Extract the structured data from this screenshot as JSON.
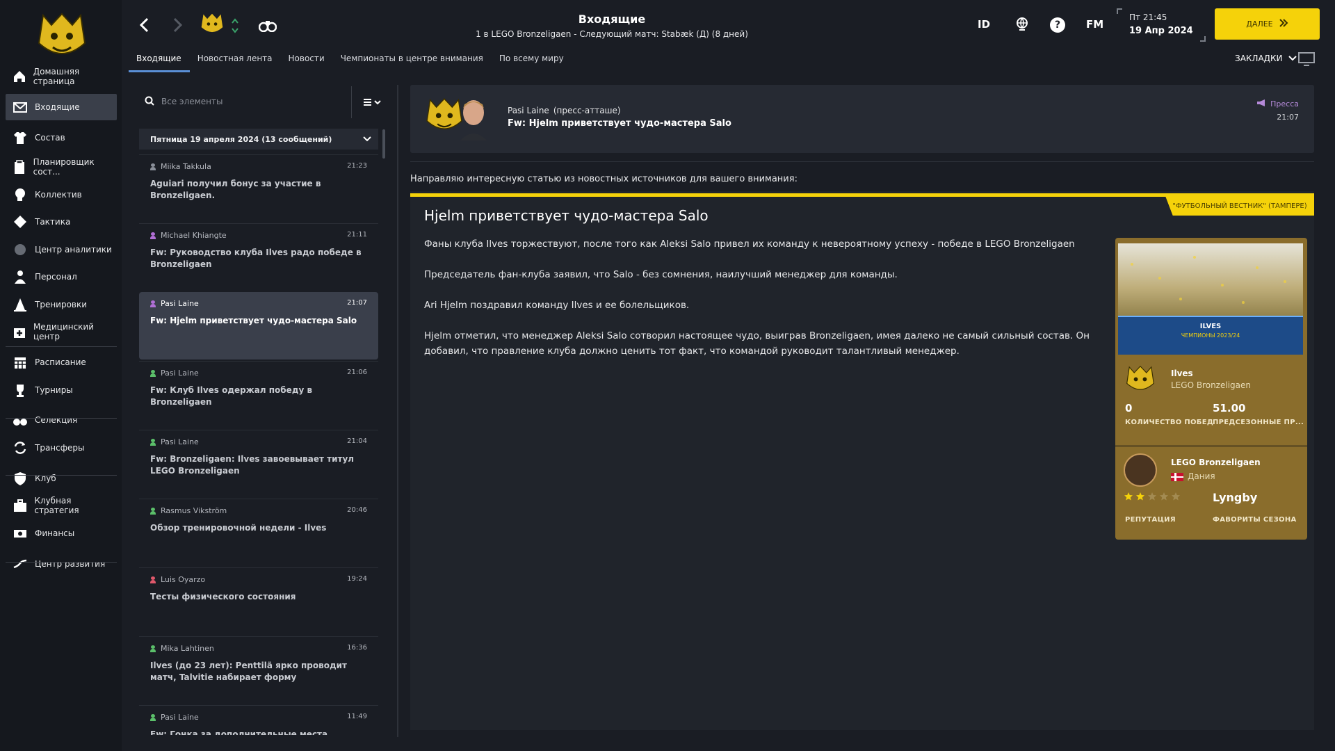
{
  "colors": {
    "accent": "#f5d20a",
    "tab_underline": "#5a8fd6",
    "card": "#8a6d2c"
  },
  "sidebar": {
    "items": [
      {
        "label": "Домашняя страница",
        "icon": "home-icon"
      },
      {
        "label": "Входящие",
        "icon": "mail-icon"
      },
      {
        "label": "Состав",
        "icon": "shirt-icon"
      },
      {
        "label": "Планировщик сост...",
        "icon": "clipboard-icon"
      },
      {
        "label": "Коллектив",
        "icon": "head-icon"
      },
      {
        "label": "Тактика",
        "icon": "tactics-icon"
      },
      {
        "label": "Центр аналитики",
        "icon": "analytics-icon"
      },
      {
        "label": "Персонал",
        "icon": "staff-icon"
      },
      {
        "label": "Тренировки",
        "icon": "cone-icon"
      },
      {
        "label": "Медицинский центр",
        "icon": "medical-icon"
      },
      {
        "label": "Расписание",
        "icon": "calendar-icon"
      },
      {
        "label": "Турниры",
        "icon": "trophy-icon"
      },
      {
        "label": "Селекция",
        "icon": "binoculars-icon"
      },
      {
        "label": "Трансферы",
        "icon": "transfer-icon"
      },
      {
        "label": "Клуб",
        "icon": "shield-icon"
      },
      {
        "label": "Клубная стратегия",
        "icon": "briefcase-icon"
      },
      {
        "label": "Финансы",
        "icon": "money-icon"
      },
      {
        "label": "Центр развития",
        "icon": "development-icon"
      }
    ]
  },
  "header": {
    "title": "Входящие",
    "subtitle": "1 в LEGO Bronzeligaen - Следующий матч: Stabæk (Д) (8 дней)",
    "id_label": "ID",
    "fm_label": "FM",
    "day_time": "Пт 21:45",
    "date": "19 Апр 2024",
    "next_label": "ДАЛЕЕ",
    "bookmarks_label": "ЗАКЛАДКИ"
  },
  "tabs": [
    "Входящие",
    "Новостная лента",
    "Новости",
    "Чемпионаты в центре внимания",
    "По всему миру"
  ],
  "search": {
    "placeholder": "Все элементы"
  },
  "group": {
    "label": "Пятница 19 апреля 2024 (13 сообщений)"
  },
  "messages": [
    {
      "sender": "Miika Takkula",
      "time": "21:23",
      "subject": "Aguiari получил бонус за участие в Bronzeligaen.",
      "color": "#8a8f99"
    },
    {
      "sender": "Michael Khiangte",
      "time": "21:11",
      "subject": "Fw: Руководство клуба Ilves радо победе в Bronzeligaen",
      "color": "#b16fd6"
    },
    {
      "sender": "Pasi Laine",
      "time": "21:07",
      "subject": "Fw: Hjelm приветствует чудо-мастера Salo",
      "color": "#b16fd6"
    },
    {
      "sender": "Pasi Laine",
      "time": "21:06",
      "subject": "Fw: Клуб Ilves одержал победу в Bronzeligaen",
      "color": "#5bbf6a"
    },
    {
      "sender": "Pasi Laine",
      "time": "21:04",
      "subject": "Fw: Bronzeligaen: Ilves завоевывает титул LEGO Bronzeligaen",
      "color": "#5bbf6a"
    },
    {
      "sender": "Rasmus Vikström",
      "time": "20:46",
      "subject": "Обзор тренировочной недели - Ilves",
      "color": "#5bbf6a"
    },
    {
      "sender": "Luis Oyarzo",
      "time": "19:24",
      "subject": "Тесты физического состояния",
      "color": "#e0586b"
    },
    {
      "sender": "Mika Lahtinen",
      "time": "16:36",
      "subject": "Ilves (до 23 лет): Penttilä ярко проводит матч, Talvitie набирает форму",
      "color": "#5bbf6a"
    },
    {
      "sender": "Pasi Laine",
      "time": "11:49",
      "subject": "Fw: Гонка за дополнительные места",
      "color": "#5bbf6a"
    }
  ],
  "detail": {
    "sender": "Pasi Laine",
    "role": "(пресс-атташе)",
    "subject": "Fw: Hjelm приветствует чудо-мастера Salo",
    "category": "Пресса",
    "time": "21:07",
    "intro": "Направляю интересную статью из новостных источников для вашего внимания:",
    "source": "\"ФУТБОЛЬНЫЙ ВЕСТНИК\" (ТАМПЕРЕ)",
    "article_title": "Hjelm приветствует чудо-мастера Salo",
    "paragraphs": [
      "Фаны клуба Ilves торжествуют, после того как Aleksi Salo привел их команду к невероятному успеху - победе в LEGO Bronzeligaen",
      "Председатель фан-клуба заявил, что Salo - без сомнения, наилучший менеджер для команды.",
      "Ari Hjelm поздравил команду Ilves и ее болельщиков.",
      "Hjelm отметил, что менеджер Aleksi Salo сотворил настоящее чудо, выиграв Bronzeligaen, имея далеко не самый сильный состав. Он добавил, что правление клуба должно ценить тот факт, что командой руководит талантливый менеджер."
    ]
  },
  "club_card": {
    "banner_title": "ILVES",
    "banner_sub": "ЧЕМПИОНЫ 2023/24",
    "club_name": "Ilves",
    "club_league": "LEGO Bronzeligaen",
    "wins_value": "0",
    "wins_label": "КОЛИЧЕСТВО ПОБЕД",
    "preseason_value": "51.00",
    "preseason_label": "ПРЕДСЕЗОННЫЕ ПР...",
    "league_name": "LEGO Bronzeligaen",
    "country": "Дания",
    "reputation_stars": 2,
    "reputation_max": 5,
    "reputation_label": "РЕПУТАЦИЯ",
    "favourite": "Lyngby",
    "favourite_label": "ФАВОРИТЫ СЕЗОНА"
  }
}
